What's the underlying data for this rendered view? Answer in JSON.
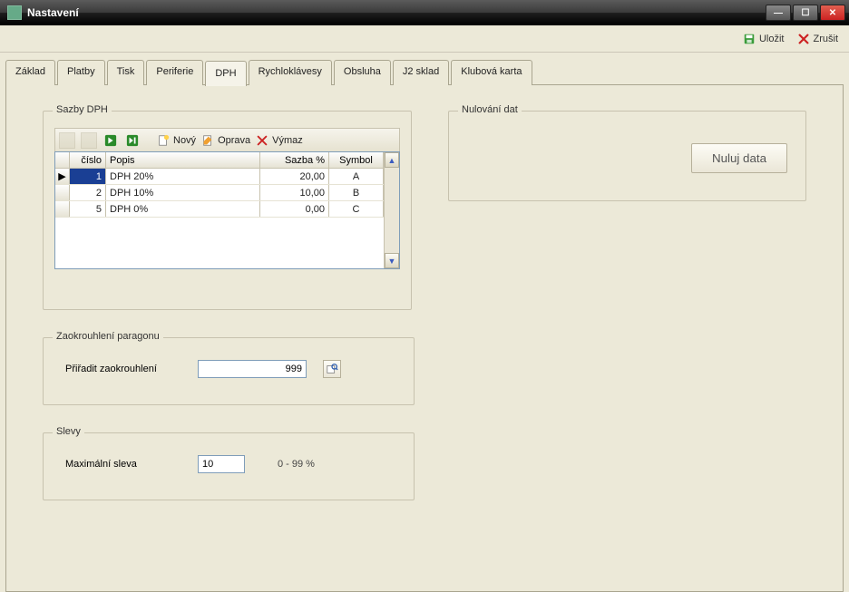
{
  "window": {
    "title": "Nastavení"
  },
  "toolbar": {
    "save": "Uložit",
    "cancel": "Zrušit"
  },
  "tabs": [
    "Základ",
    "Platby",
    "Tisk",
    "Periferie",
    "DPH",
    "Rychloklávesy",
    "Obsluha",
    "J2 sklad",
    "Klubová karta"
  ],
  "active_tab_index": 4,
  "groups": {
    "sazby": {
      "title": "Sazby DPH",
      "toolbar": {
        "novy": "Nový",
        "oprava": "Oprava",
        "vymaz": "Výmaz"
      },
      "columns": {
        "cislo": "číslo",
        "popis": "Popis",
        "sazba": "Sazba %",
        "symbol": "Symbol"
      },
      "rows": [
        {
          "cislo": "1",
          "popis": "DPH 20%",
          "sazba": "20,00",
          "symbol": "A",
          "selected": true
        },
        {
          "cislo": "2",
          "popis": "DPH 10%",
          "sazba": "10,00",
          "symbol": "B",
          "selected": false
        },
        {
          "cislo": "5",
          "popis": "DPH 0%",
          "sazba": "0,00",
          "symbol": "C",
          "selected": false
        }
      ]
    },
    "nulovani": {
      "title": "Nulování dat",
      "button": "Nuluj data"
    },
    "zaokrouhleni": {
      "title": "Zaokrouhlení paragonu",
      "label": "Přiřadit zaokrouhlení",
      "value": "999"
    },
    "slevy": {
      "title": "Slevy",
      "label": "Maximální sleva",
      "value": "10",
      "hint": "0 - 99 %"
    }
  }
}
